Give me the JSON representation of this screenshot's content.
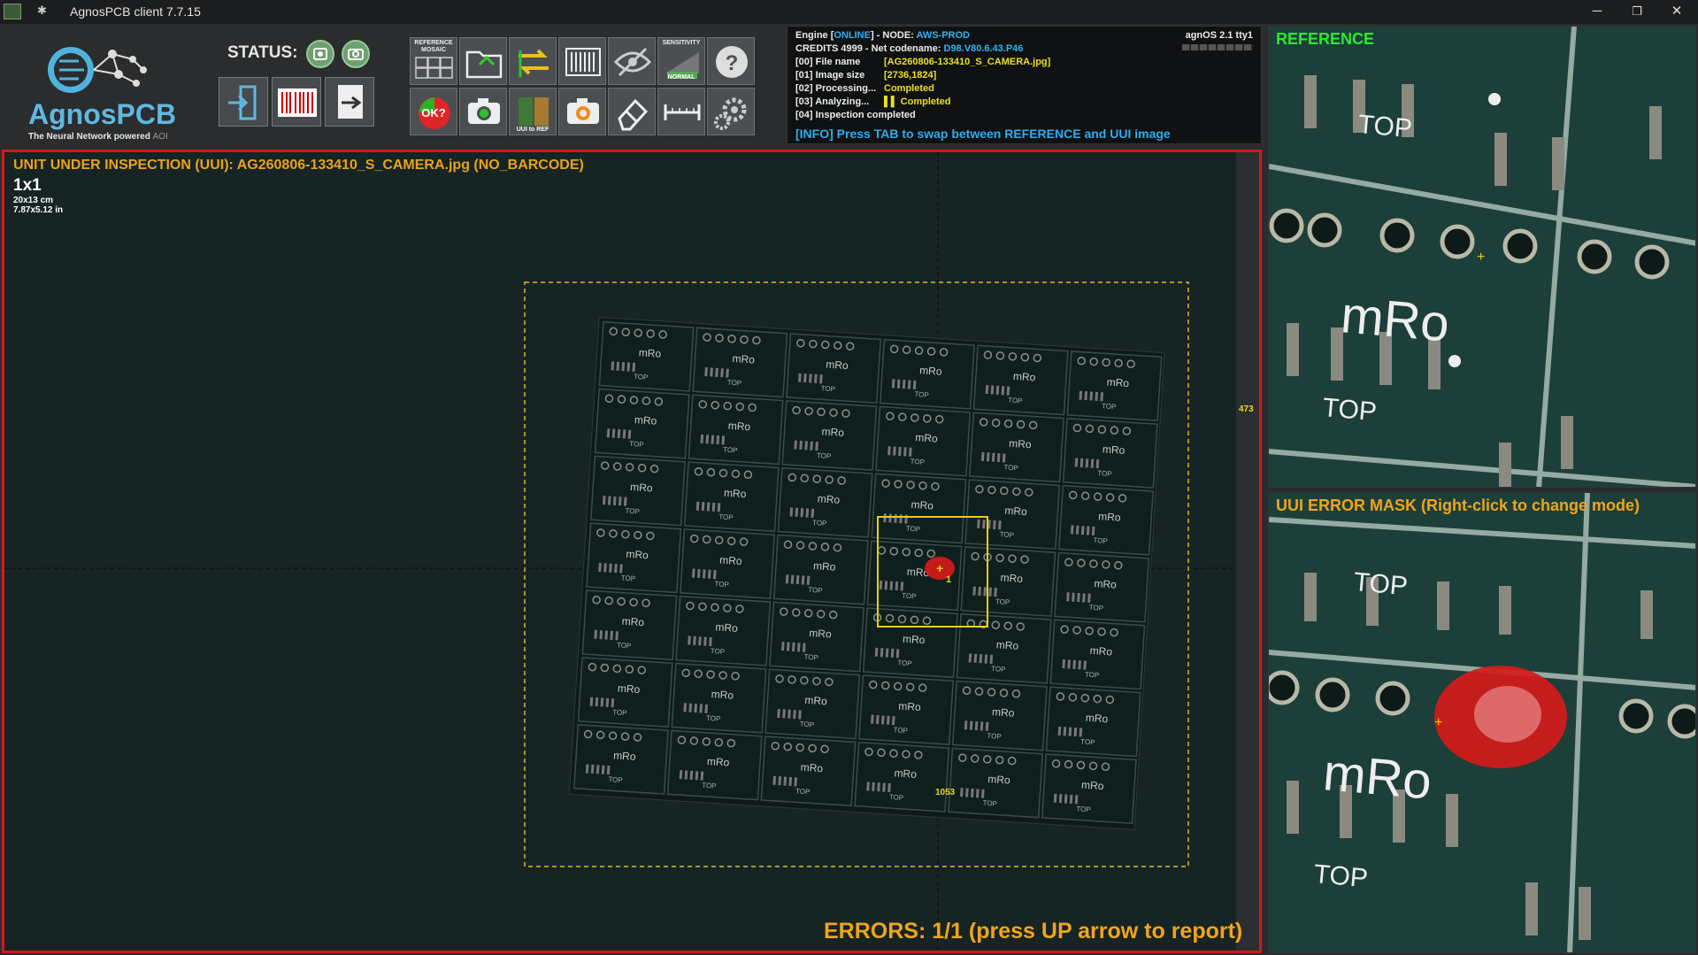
{
  "window": {
    "title": "AgnosPCB client 7.7.15",
    "minimize": "─",
    "maximize": "❐",
    "close": "✕"
  },
  "logo": {
    "brand": "AgnosPCB",
    "tagline": "The Neural Network powered",
    "tagline_suffix": "AOI"
  },
  "status": {
    "label": "STATUS:"
  },
  "toolbar": {
    "reference_mosaic": "REFERENCE MOSAIC",
    "sensitivity": "SENSITIVITY",
    "sensitivity_level": "NORMAL",
    "ok_label": "OK?",
    "uui_to_ref": "UUI to REF"
  },
  "engine": {
    "line0_a": "Engine [",
    "online": "ONLINE",
    "line0_b": "] - NODE:",
    "node": "AWS-PROD",
    "credits": "CREDITS 4999 - Net codename:",
    "codename": "D98.V80.6.43.P46",
    "file_label": "[00] File name",
    "file_value": "[AG260806-133410_S_CAMERA.jpg]",
    "size_label": "[01] Image size",
    "size_value": "[2736,1824]",
    "proc_label": "[02] Processing...",
    "proc_value": "Completed",
    "anal_label": "[03] Analyzing...",
    "anal_value": "Completed",
    "insp": "[04] Inspection completed",
    "os": "agnOS 2.1 tty1",
    "tip": "[INFO] Press TAB to swap between REFERENCE and UUI image"
  },
  "uui": {
    "header": "UNIT UNDER INSPECTION (UUI): AG260806-133410_S_CAMERA.jpg (NO_BARCODE)",
    "grid": "1x1",
    "size_cm": "20x13 cm",
    "size_in": "7.87x5.12 in",
    "errors": "ERRORS: 1/1 (press UP arrow to report)",
    "coord_x": "1053",
    "coord_y": "473",
    "error_number": "1"
  },
  "reference": {
    "title": "REFERENCE"
  },
  "mask": {
    "title": "UUI ERROR MASK (Right-click to change mode)"
  },
  "pcb": {
    "silk_text": "mRo",
    "top_text": "TOP"
  },
  "colors": {
    "accent": "#e9a31d",
    "error": "#d61818",
    "info": "#34b3ef",
    "ok": "#6fa070",
    "ref_title": "#2ee82e"
  }
}
